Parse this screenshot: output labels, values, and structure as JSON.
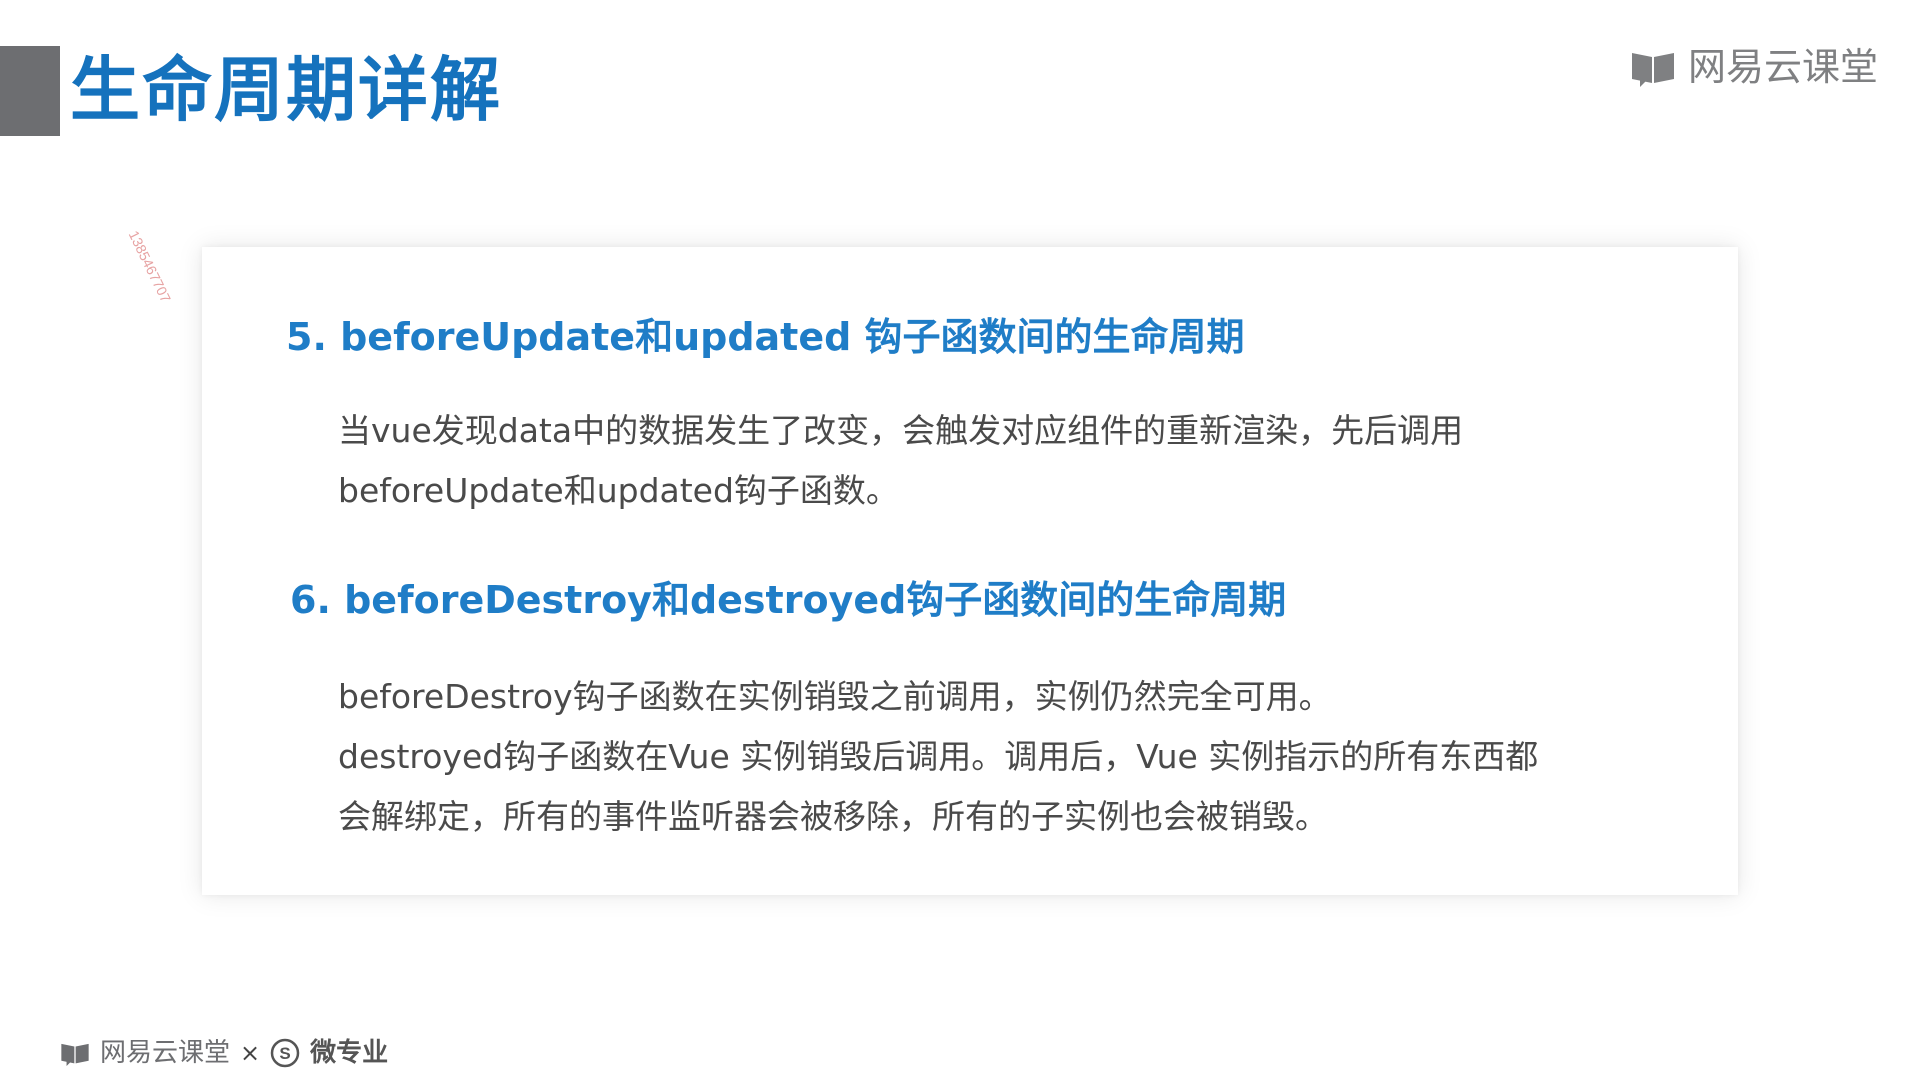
{
  "header": {
    "title": "生命周期详解",
    "brand": "网易云课堂"
  },
  "watermark": "1385467707",
  "sections": [
    {
      "heading": "5. beforeUpdate和updated 钩子函数间的生命周期",
      "lines": [
        "当vue发现data中的数据发生了改变，会触发对应组件的重新渲染，先后调用",
        "beforeUpdate和updated钩子函数。"
      ]
    },
    {
      "heading": "6. beforeDestroy和destroyed钩子函数间的生命周期",
      "lines": [
        "beforeDestroy钩子函数在实例销毁之前调用，实例仍然完全可用。",
        "destroyed钩子函数在Vue 实例销毁后调用。调用后，Vue 实例指示的所有东西都",
        "会解绑定，所有的事件监听器会被移除，所有的子实例也会被销毁。"
      ]
    }
  ],
  "footer": {
    "brand": "网易云课堂",
    "separator": "×",
    "program": "微专业"
  },
  "icons": {
    "brand": "book-icon",
    "program": "s-circle-icon"
  },
  "colors": {
    "title": "#1572bd",
    "heading": "#1f7dc7",
    "accent_bar": "#6d6e71",
    "body_text": "#4a4a4a"
  }
}
